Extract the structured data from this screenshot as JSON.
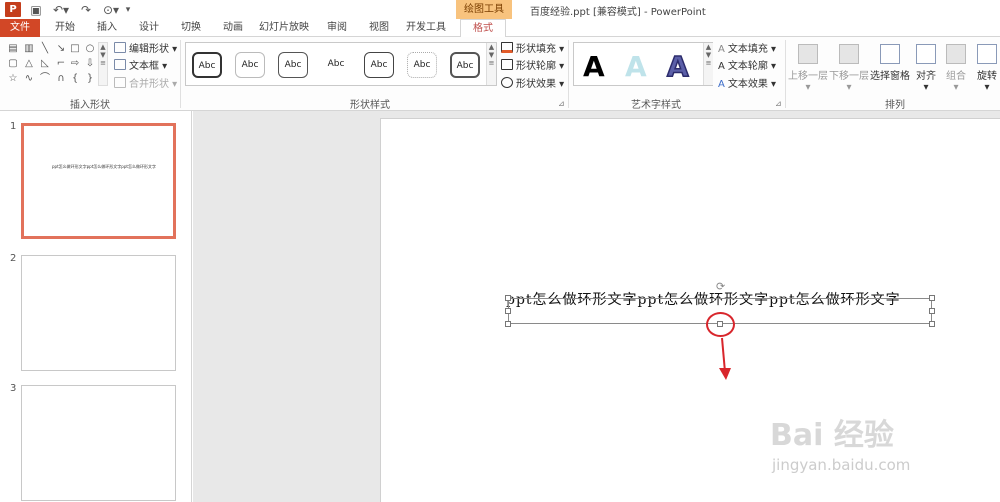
{
  "quick_access": {
    "save_icon": "save-icon",
    "undo_icon": "undo-icon",
    "redo_icon": "redo-icon",
    "customize_icon": "customize-icon"
  },
  "context_tab_header": "绘图工具",
  "window_title": "百度经验.ppt [兼容模式] - PowerPoint",
  "tabs": [
    {
      "label": "文件"
    },
    {
      "label": "开始"
    },
    {
      "label": "插入"
    },
    {
      "label": "设计"
    },
    {
      "label": "切换"
    },
    {
      "label": "动画"
    },
    {
      "label": "幻灯片放映"
    },
    {
      "label": "审阅"
    },
    {
      "label": "视图"
    },
    {
      "label": "开发工具"
    },
    {
      "label": "格式"
    }
  ],
  "ribbon": {
    "insert_shapes": {
      "edit_shape": "编辑形状",
      "text_box": "文本框",
      "merge_shapes": "合并形状",
      "group_label": "插入形状"
    },
    "shape_styles": {
      "style_sample": "Abc",
      "fill": "形状填充",
      "outline": "形状轮廓",
      "effects": "形状效果",
      "group_label": "形状样式"
    },
    "wordart": {
      "sample": "A",
      "text_fill": "文本填充",
      "text_outline": "文本轮廓",
      "text_effects": "文本效果",
      "group_label": "艺术字样式"
    },
    "arrange": {
      "bring_forward": "上移一层",
      "send_backward": "下移一层",
      "selection_pane": "选择窗格",
      "align": "对齐",
      "group": "组合",
      "rotate": "旋转",
      "group_label": "排列"
    }
  },
  "slides": [
    {
      "number": "1",
      "text": "ppt怎么做环形文字ppt怎么做环形文字ppt怎么做环形文字"
    },
    {
      "number": "2"
    },
    {
      "number": "3"
    }
  ],
  "slide_text": "ppt怎么做环形文字ppt怎么做环形文字ppt怎么做环形文字",
  "watermark": {
    "brand": "Bai 经验",
    "url": "jingyan.baidu.com"
  },
  "colors": {
    "accent": "#d24726",
    "annotation": "#d8262c",
    "context_tab": "#f8c37e"
  }
}
